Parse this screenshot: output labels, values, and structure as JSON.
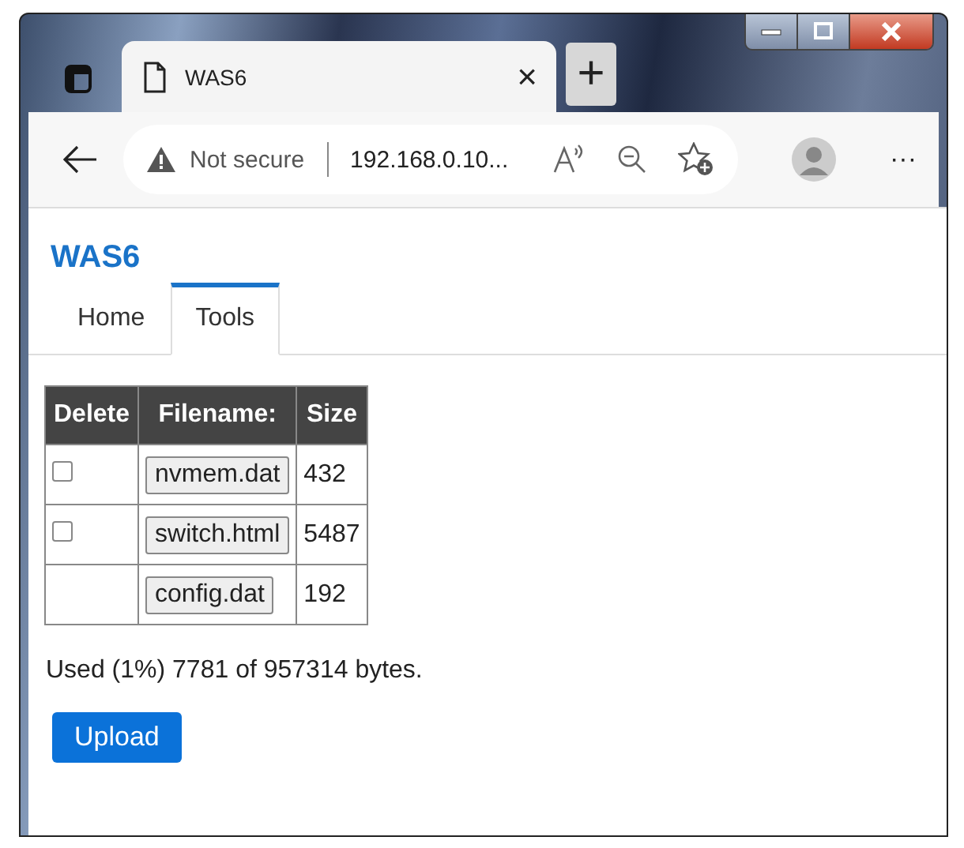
{
  "browser": {
    "tab_title": "WAS6",
    "security": "Not secure",
    "address": "192.168.0.10...",
    "more": "···",
    "new_tab": "+",
    "close_tab": "×"
  },
  "page": {
    "title": "WAS6",
    "tabs": [
      {
        "label": "Home",
        "selected": false
      },
      {
        "label": "Tools",
        "selected": true
      }
    ],
    "table": {
      "columns": [
        "Delete",
        "Filename:",
        "Size"
      ],
      "rows": [
        {
          "kind": "deletable",
          "checked": false,
          "filename": "nvmem.dat",
          "size": "432"
        },
        {
          "kind": "deletable",
          "checked": false,
          "filename": "switch.html",
          "size": "5487"
        },
        {
          "kind": "fixed",
          "filename": "config.dat",
          "size": "192"
        }
      ]
    },
    "usage": "Used (1%) 7781 of 957314 bytes.",
    "upload_button": "Upload"
  }
}
